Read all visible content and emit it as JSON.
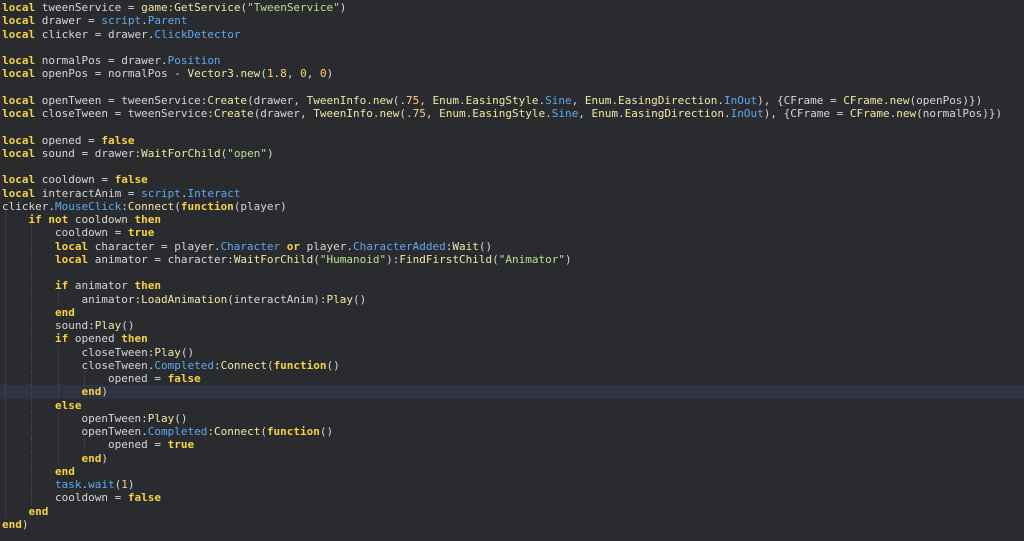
{
  "editor": {
    "current_line": 29,
    "colors": {
      "background": "#2a2b2e",
      "current_line": "#2f3341",
      "keyword": "#f5d343",
      "string": "#b9e090",
      "number": "#ffd27a",
      "property": "#5fa8f0",
      "method": "#f2e7a6",
      "text": "#d6d6d6"
    },
    "lines": [
      {
        "indent": 0,
        "tokens": [
          [
            "kw",
            "local"
          ],
          [
            "id",
            " tweenService = "
          ],
          [
            "fn",
            "game"
          ],
          [
            "id",
            ":"
          ],
          [
            "fn",
            "GetService"
          ],
          [
            "id",
            "("
          ],
          [
            "str",
            "\"TweenService\""
          ],
          [
            "id",
            ")"
          ]
        ]
      },
      {
        "indent": 0,
        "tokens": [
          [
            "kw",
            "local"
          ],
          [
            "id",
            " drawer = "
          ],
          [
            "prop",
            "script"
          ],
          [
            "id",
            "."
          ],
          [
            "prop",
            "Parent"
          ]
        ]
      },
      {
        "indent": 0,
        "tokens": [
          [
            "kw",
            "local"
          ],
          [
            "id",
            " clicker = drawer."
          ],
          [
            "prop",
            "ClickDetector"
          ]
        ]
      },
      {
        "indent": 0,
        "tokens": []
      },
      {
        "indent": 0,
        "tokens": [
          [
            "kw",
            "local"
          ],
          [
            "id",
            " normalPos = drawer."
          ],
          [
            "prop",
            "Position"
          ]
        ]
      },
      {
        "indent": 0,
        "tokens": [
          [
            "kw",
            "local"
          ],
          [
            "id",
            " openPos = normalPos - "
          ],
          [
            "fn",
            "Vector3"
          ],
          [
            "id",
            "."
          ],
          [
            "fn",
            "new"
          ],
          [
            "id",
            "("
          ],
          [
            "num",
            "1.8"
          ],
          [
            "id",
            ", "
          ],
          [
            "num",
            "0"
          ],
          [
            "id",
            ", "
          ],
          [
            "num",
            "0"
          ],
          [
            "id",
            ")"
          ]
        ]
      },
      {
        "indent": 0,
        "tokens": []
      },
      {
        "indent": 0,
        "tokens": [
          [
            "kw",
            "local"
          ],
          [
            "id",
            " openTween = tweenService:"
          ],
          [
            "fn",
            "Create"
          ],
          [
            "id",
            "(drawer, "
          ],
          [
            "fn",
            "TweenInfo"
          ],
          [
            "id",
            "."
          ],
          [
            "fn",
            "new"
          ],
          [
            "id",
            "(."
          ],
          [
            "num",
            "75"
          ],
          [
            "id",
            ", "
          ],
          [
            "fn",
            "Enum"
          ],
          [
            "id",
            "."
          ],
          [
            "fn",
            "EasingStyle"
          ],
          [
            "id",
            "."
          ],
          [
            "prop",
            "Sine"
          ],
          [
            "id",
            ", "
          ],
          [
            "fn",
            "Enum"
          ],
          [
            "id",
            "."
          ],
          [
            "fn",
            "EasingDirection"
          ],
          [
            "id",
            "."
          ],
          [
            "prop",
            "InOut"
          ],
          [
            "id",
            "), {CFrame = "
          ],
          [
            "fn",
            "CFrame"
          ],
          [
            "id",
            "."
          ],
          [
            "fn",
            "new"
          ],
          [
            "id",
            "(openPos)})"
          ]
        ]
      },
      {
        "indent": 0,
        "tokens": [
          [
            "kw",
            "local"
          ],
          [
            "id",
            " closeTween = tweenService:"
          ],
          [
            "fn",
            "Create"
          ],
          [
            "id",
            "(drawer, "
          ],
          [
            "fn",
            "TweenInfo"
          ],
          [
            "id",
            "."
          ],
          [
            "fn",
            "new"
          ],
          [
            "id",
            "(."
          ],
          [
            "num",
            "75"
          ],
          [
            "id",
            ", "
          ],
          [
            "fn",
            "Enum"
          ],
          [
            "id",
            "."
          ],
          [
            "fn",
            "EasingStyle"
          ],
          [
            "id",
            "."
          ],
          [
            "prop",
            "Sine"
          ],
          [
            "id",
            ", "
          ],
          [
            "fn",
            "Enum"
          ],
          [
            "id",
            "."
          ],
          [
            "fn",
            "EasingDirection"
          ],
          [
            "id",
            "."
          ],
          [
            "prop",
            "InOut"
          ],
          [
            "id",
            "), {CFrame = "
          ],
          [
            "fn",
            "CFrame"
          ],
          [
            "id",
            "."
          ],
          [
            "fn",
            "new"
          ],
          [
            "id",
            "(normalPos)})"
          ]
        ]
      },
      {
        "indent": 0,
        "tokens": []
      },
      {
        "indent": 0,
        "tokens": [
          [
            "kw",
            "local"
          ],
          [
            "id",
            " opened = "
          ],
          [
            "kw",
            "false"
          ]
        ]
      },
      {
        "indent": 0,
        "tokens": [
          [
            "kw",
            "local"
          ],
          [
            "id",
            " sound = drawer:"
          ],
          [
            "fn",
            "WaitForChild"
          ],
          [
            "id",
            "("
          ],
          [
            "str",
            "\"open\""
          ],
          [
            "id",
            ")"
          ]
        ]
      },
      {
        "indent": 0,
        "tokens": []
      },
      {
        "indent": 0,
        "tokens": [
          [
            "kw",
            "local"
          ],
          [
            "id",
            " cooldown = "
          ],
          [
            "kw",
            "false"
          ]
        ]
      },
      {
        "indent": 0,
        "tokens": [
          [
            "kw",
            "local"
          ],
          [
            "id",
            " interactAnim = "
          ],
          [
            "prop",
            "script"
          ],
          [
            "id",
            "."
          ],
          [
            "prop",
            "Interact"
          ]
        ]
      },
      {
        "indent": 0,
        "tokens": [
          [
            "id",
            "clicker."
          ],
          [
            "prop",
            "MouseClick"
          ],
          [
            "id",
            ":"
          ],
          [
            "fn",
            "Connect"
          ],
          [
            "id",
            "("
          ],
          [
            "kw",
            "function"
          ],
          [
            "id",
            "(player)"
          ]
        ]
      },
      {
        "indent": 1,
        "tokens": [
          [
            "kw",
            "if"
          ],
          [
            "id",
            " "
          ],
          [
            "kw",
            "not"
          ],
          [
            "id",
            " cooldown "
          ],
          [
            "kw",
            "then"
          ]
        ]
      },
      {
        "indent": 2,
        "tokens": [
          [
            "id",
            "cooldown = "
          ],
          [
            "kw",
            "true"
          ]
        ]
      },
      {
        "indent": 2,
        "tokens": [
          [
            "kw",
            "local"
          ],
          [
            "id",
            " character = player."
          ],
          [
            "prop",
            "Character"
          ],
          [
            "id",
            " "
          ],
          [
            "kw",
            "or"
          ],
          [
            "id",
            " player."
          ],
          [
            "prop",
            "CharacterAdded"
          ],
          [
            "id",
            ":"
          ],
          [
            "fn",
            "Wait"
          ],
          [
            "id",
            "()"
          ]
        ]
      },
      {
        "indent": 2,
        "tokens": [
          [
            "kw",
            "local"
          ],
          [
            "id",
            " animator = character:"
          ],
          [
            "fn",
            "WaitForChild"
          ],
          [
            "id",
            "("
          ],
          [
            "str",
            "\"Humanoid\""
          ],
          [
            "id",
            "):"
          ],
          [
            "fn",
            "FindFirstChild"
          ],
          [
            "id",
            "("
          ],
          [
            "str",
            "\"Animator\""
          ],
          [
            "id",
            ")"
          ]
        ]
      },
      {
        "indent": 2,
        "tokens": []
      },
      {
        "indent": 2,
        "tokens": [
          [
            "kw",
            "if"
          ],
          [
            "id",
            " animator "
          ],
          [
            "kw",
            "then"
          ]
        ]
      },
      {
        "indent": 3,
        "tokens": [
          [
            "id",
            "animator:"
          ],
          [
            "fn",
            "LoadAnimation"
          ],
          [
            "id",
            "(interactAnim):"
          ],
          [
            "fn",
            "Play"
          ],
          [
            "id",
            "()"
          ]
        ]
      },
      {
        "indent": 2,
        "tokens": [
          [
            "kw",
            "end"
          ]
        ]
      },
      {
        "indent": 2,
        "tokens": [
          [
            "id",
            "sound:"
          ],
          [
            "fn",
            "Play"
          ],
          [
            "id",
            "()"
          ]
        ]
      },
      {
        "indent": 2,
        "tokens": [
          [
            "kw",
            "if"
          ],
          [
            "id",
            " opened "
          ],
          [
            "kw",
            "then"
          ]
        ]
      },
      {
        "indent": 3,
        "tokens": [
          [
            "id",
            "closeTween:"
          ],
          [
            "fn",
            "Play"
          ],
          [
            "id",
            "()"
          ]
        ]
      },
      {
        "indent": 3,
        "tokens": [
          [
            "id",
            "closeTween."
          ],
          [
            "prop",
            "Completed"
          ],
          [
            "id",
            ":"
          ],
          [
            "fn",
            "Connect"
          ],
          [
            "id",
            "("
          ],
          [
            "kw",
            "function"
          ],
          [
            "id",
            "()"
          ]
        ]
      },
      {
        "indent": 4,
        "tokens": [
          [
            "id",
            "opened = "
          ],
          [
            "kw",
            "false"
          ]
        ]
      },
      {
        "indent": 3,
        "tokens": [
          [
            "kw",
            "end"
          ],
          [
            "id",
            ")"
          ]
        ]
      },
      {
        "indent": 2,
        "tokens": [
          [
            "kw",
            "else"
          ]
        ]
      },
      {
        "indent": 3,
        "tokens": [
          [
            "id",
            "openTween:"
          ],
          [
            "fn",
            "Play"
          ],
          [
            "id",
            "()"
          ]
        ]
      },
      {
        "indent": 3,
        "tokens": [
          [
            "id",
            "openTween."
          ],
          [
            "prop",
            "Completed"
          ],
          [
            "id",
            ":"
          ],
          [
            "fn",
            "Connect"
          ],
          [
            "id",
            "("
          ],
          [
            "kw",
            "function"
          ],
          [
            "id",
            "()"
          ]
        ]
      },
      {
        "indent": 4,
        "tokens": [
          [
            "id",
            "opened = "
          ],
          [
            "kw",
            "true"
          ]
        ]
      },
      {
        "indent": 3,
        "tokens": [
          [
            "kw",
            "end"
          ],
          [
            "id",
            ")"
          ]
        ]
      },
      {
        "indent": 2,
        "tokens": [
          [
            "kw",
            "end"
          ]
        ]
      },
      {
        "indent": 2,
        "tokens": [
          [
            "prop",
            "task"
          ],
          [
            "id",
            "."
          ],
          [
            "prop",
            "wait"
          ],
          [
            "id",
            "("
          ],
          [
            "num",
            "1"
          ],
          [
            "id",
            ")"
          ]
        ]
      },
      {
        "indent": 2,
        "tokens": [
          [
            "id",
            "cooldown = "
          ],
          [
            "kw",
            "false"
          ]
        ]
      },
      {
        "indent": 1,
        "tokens": [
          [
            "kw",
            "end"
          ]
        ]
      },
      {
        "indent": 0,
        "tokens": [
          [
            "kw",
            "end"
          ],
          [
            "id",
            ")"
          ]
        ]
      }
    ]
  }
}
